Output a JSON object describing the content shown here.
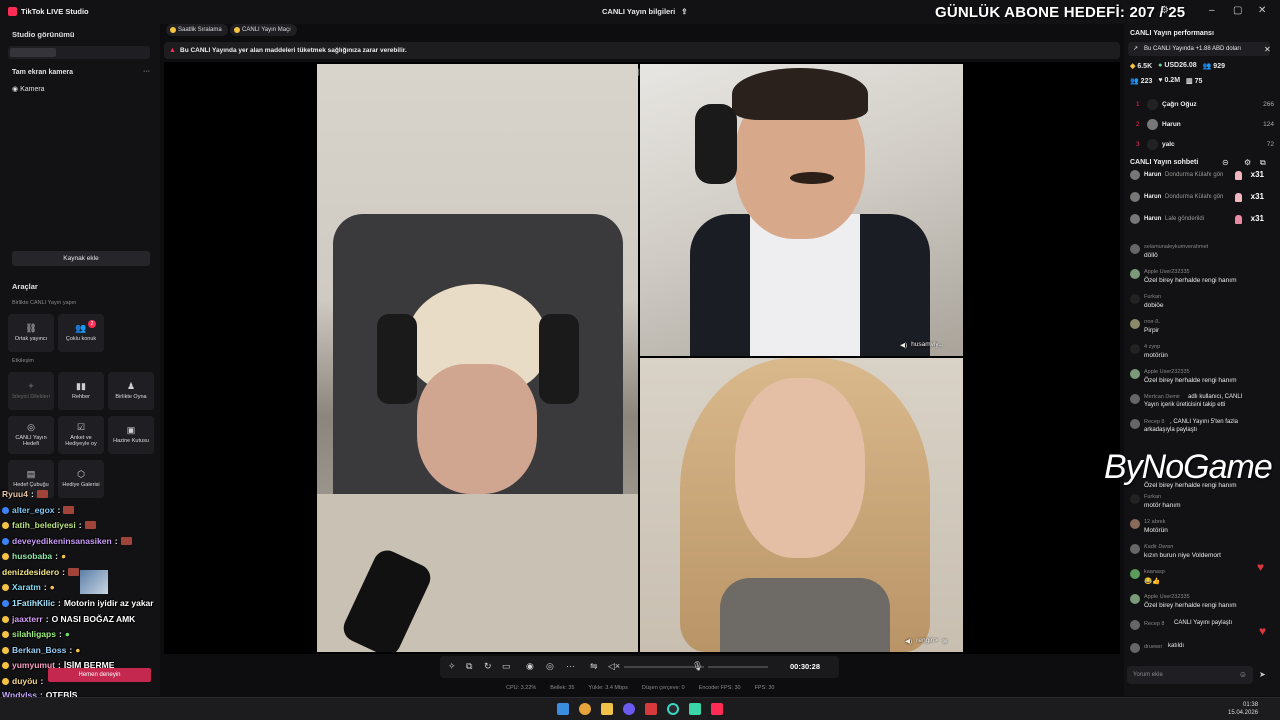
{
  "titlebar": {
    "app_name": "TikTok LIVE Studio",
    "center_title": "CANLI Yayın bilgileri",
    "goal_overlay": "GÜNLÜK ABONE HEDEFİ: 207 / 25"
  },
  "sidebar": {
    "studio_view": "Studio görünümü",
    "fullscreen_camera": "Tam ekran kamera",
    "camera": "Kamera",
    "add_source": "Kaynak ekle",
    "tools": "Araçlar",
    "together_live": "Birlikte CANLI Yayın yapın",
    "co_host": "Ortak yayıncı",
    "multi_guest": "Çoklu konuk",
    "multi_guest_badge": "2",
    "interaction": "Etkileşim",
    "tiles": [
      "İzleyici Dilekleri",
      "Rehber",
      "Birlikte Oyna",
      "CANLI Yayın Hedefi",
      "Anket ve Hediyeyle oy",
      "Hazine Kutusu",
      "Hedef Çubuğu",
      "Hediye Galerisi"
    ]
  },
  "chat_overlay": [
    {
      "user": "Ryuu4",
      "sep": " : ",
      "msg": "",
      "color": "#e6c3a5"
    },
    {
      "user": "alter_egox",
      "sep": " : ",
      "msg": "",
      "color": "#7bc6f5"
    },
    {
      "user": "fatih_belediyesi",
      "sep": " : ",
      "msg": "",
      "color": "#b9e07b"
    },
    {
      "user": "deveyedikeninsanasiken",
      "sep": " : ",
      "msg": "",
      "color": "#c89bf7"
    },
    {
      "user": "husobaba",
      "sep": " : ",
      "msg": "",
      "color": "#8ee6a8"
    },
    {
      "user": "denizdesidero",
      "sep": " : ",
      "msg": "",
      "color": "#f2e58c"
    },
    {
      "user": "Xaratm",
      "sep": " : ",
      "msg": "",
      "color": "#7fdcf5"
    },
    {
      "user": "1FatihKilic",
      "sep": " : ",
      "msg": "Motorin iyidir az yakar",
      "color": "#a6e6ff"
    },
    {
      "user": "jaaxterr",
      "sep": " : ",
      "msg": "O NASI BOĞAZ AMK",
      "color": "#d79ef5"
    },
    {
      "user": "silahligaps",
      "sep": " : ",
      "msg": "",
      "color": "#9cf07e"
    },
    {
      "user": "Berkan_Boss",
      "sep": " : ",
      "msg": "",
      "color": "#9ad0f7"
    },
    {
      "user": "yumyumut",
      "sep": " : ",
      "msg": "İSİM BERME",
      "color": "#f79ec1"
    },
    {
      "user": "duyöu",
      "sep": " : ",
      "msg": "",
      "color": "#f5d78a"
    },
    {
      "user": "Wndylss",
      "sep": " : ",
      "msg": "OTEBİS",
      "color": "#c7a8ff"
    }
  ],
  "try_now": "Hemen deneyin",
  "tabs": [
    {
      "label": "Saatlik Sıralama"
    },
    {
      "label": "CANLI Yayın Maçı"
    }
  ],
  "warning": "Bu CANLI Yayında yer alan maddeleri tüketmek sağlığınıza zarar verebilir.",
  "stage": {
    "guest_top": "husamviy...",
    "guest_bottom": "rengin>",
    "timer": "00:30:28"
  },
  "stats": [
    "CPU: 3.22%",
    "Bellek: 35",
    "Yükle: 3.4 Mbps",
    "Düşen çerçeve: 0",
    "Encoder FPS: 30",
    "FPS: 30"
  ],
  "right": {
    "perf_title": "CANLI Yayın performansı",
    "perf_note": "Bu CANLI Yayında +1.88 ABD doları",
    "m1": "6.5K",
    "m2": "USD26.08",
    "m3": "929",
    "m4": "223",
    "m5": "0.2M",
    "m6": "75",
    "ranking": [
      {
        "rank": "1",
        "name": "Çağrı Oğuz",
        "score": "266"
      },
      {
        "rank": "2",
        "name": "Harun",
        "score": "124"
      },
      {
        "rank": "3",
        "name": "yalc",
        "score": "72"
      }
    ],
    "chat_title": "CANLI Yayın sohbeti",
    "gifts": [
      {
        "user": "Harun",
        "gift": "Dondurma Külahı gön",
        "count": "x31"
      },
      {
        "user": "Harun",
        "gift": "Dondurma Külahı gön",
        "count": "x31"
      },
      {
        "user": "Harun",
        "gift": "Lale gönderildi",
        "count": "x31"
      }
    ],
    "messages": [
      {
        "user": "selamunaleykumverahmet",
        "text": "döllö"
      },
      {
        "user": "Apple User232335",
        "text": "Özel birey herhalde rengi hanım"
      },
      {
        "user": "Furkan",
        "text": "dobiöe"
      },
      {
        "user": "ıroя·ß.",
        "text": "Pirpir"
      },
      {
        "user": "4 zynp",
        "text": "motörün"
      },
      {
        "user": "Apple User232335",
        "text": "Özel birey herhalde rengi hanım"
      },
      {
        "user": "Mertcan Demir",
        "text": "adlı kullanıcı, CANLI"
      },
      {
        "user": "",
        "text": "Yayın içerik üreticisini takip etti"
      },
      {
        "user": "Recep 8",
        "text": ", CANLI Yayını 5'ten fazla"
      },
      {
        "user": "",
        "text": "arkadaşıyla paylaştı"
      },
      {
        "user": "",
        "text": "Özel birey herhalde rengi hanım"
      },
      {
        "user": "Furkan",
        "text": "motör hanım"
      },
      {
        "user": "12 abrek",
        "text": "Motörün"
      },
      {
        "user": "Kadir Deren",
        "text": "kızın burun niye Voldemort"
      },
      {
        "user": "kaanasp",
        "text": "😂👍"
      },
      {
        "user": "Apple User232335",
        "text": "Özel birey herhalde rengi hanım"
      },
      {
        "user": "Recep 8",
        "text": "CANLI Yayını paylaştı"
      },
      {
        "user": "druewır",
        "text": "katıldı"
      }
    ],
    "comment_placeholder": "Yorum ekle",
    "watermark": "ByNoGame"
  },
  "taskbar": {
    "time": "01:38",
    "date": "15.04.2026"
  }
}
